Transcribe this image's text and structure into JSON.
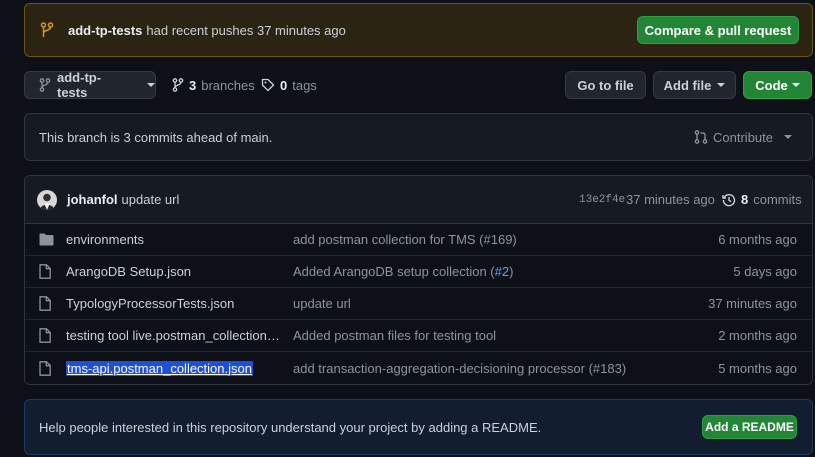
{
  "banner": {
    "branch": "add-tp-tests",
    "message": "had recent pushes 37 minutes ago",
    "button": "Compare & pull request"
  },
  "toolbar": {
    "branch": "add-tp-tests",
    "branches_count": "3",
    "branches_label": "branches",
    "tags_count": "0",
    "tags_label": "tags",
    "go_to_file": "Go to file",
    "add_file": "Add file",
    "code": "Code"
  },
  "ahead": {
    "message": "This branch is 3 commits ahead of main.",
    "contribute": "Contribute"
  },
  "latest_commit": {
    "author": "johanfol",
    "message": "update url",
    "sha": "13e2f4e",
    "time": "37 minutes ago",
    "commits_count": "8",
    "commits_label": "commits"
  },
  "files": [
    {
      "icon": "folder-icon",
      "name": "environments",
      "message": "add postman collection for TMS (#169)",
      "date": "6 months ago"
    },
    {
      "icon": "file-icon",
      "name": "ArangoDB Setup.json",
      "message": "Added ArangoDB setup collection (",
      "pr": "#2",
      "message_end": ")",
      "date": "5 days ago"
    },
    {
      "icon": "file-icon",
      "name": "TypologyProcessorTests.json",
      "message": "update url",
      "date": "37 minutes ago"
    },
    {
      "icon": "file-icon",
      "name": "testing tool live.postman_collection.js...",
      "message": "Added postman files for testing tool",
      "date": "2 months ago"
    },
    {
      "icon": "file-icon",
      "name": "tms-api.postman_collection.json",
      "message": "add transaction-aggregation-decisioning processor (#183)",
      "date": "5 months ago"
    }
  ],
  "readme": {
    "message": "Help people interested in this repository understand your project by adding a README.",
    "button": "Add a README"
  },
  "colors": {
    "background": "#0d1117",
    "green_button": "#238636",
    "banner_bg": "#2b2413",
    "banner_icon": "#d29922",
    "link_blue": "#58a6ff",
    "selection": "#1f4fd6"
  }
}
